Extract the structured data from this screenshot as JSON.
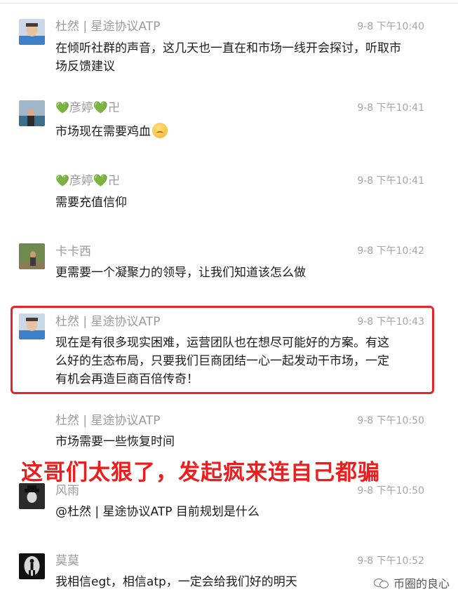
{
  "messages": [
    {
      "sender": "杜然 | 星途协议ATP",
      "time": "9-8 下午10:40",
      "text": "在倾听社群的声音，这几天也一直在和市场一线开会探讨，听取市场反馈建议",
      "avatar": "avatar-man-blue-shirt"
    },
    {
      "sender_prefix": "💚",
      "sender_name": "彦婷",
      "sender_suffix": "💚卍",
      "time": "9-8 下午10:41",
      "text": "市场现在需要鸡血",
      "avatar": "avatar-woman-lake",
      "emoji": "grimacing-face"
    },
    {
      "sender_prefix": "💚",
      "sender_name": "彦婷",
      "sender_suffix": "💚卍",
      "time": "9-8 下午10:41",
      "text": "需要充值信仰"
    },
    {
      "sender": "卡卡西",
      "time": "9-8 下午10:42",
      "text": "更需要一个凝聚力的领导，让我们知道该怎么做",
      "avatar": "avatar-outdoor-person"
    },
    {
      "sender": "杜然 | 星途协议ATP",
      "time": "9-8 下午10:43",
      "text": "现在是有很多现实困难，运营团队也在想尽可能好的方案。有这么好的生态布局，只要我们巨商团结一心一起发动干市场，一定有机会再造巨商百倍传奇！",
      "avatar": "avatar-man-blue-shirt",
      "highlighted": true
    },
    {
      "sender": "杜然 | 星途协议ATP",
      "time": "9-8 下午10:50",
      "text": "市场需要一些恢复时间"
    },
    {
      "sender": "风雨",
      "time": "9-8 下午10:50",
      "text": "@杜然 | 星途协议ATP 目前规划是什么",
      "avatar": "avatar-man-hat-dark"
    },
    {
      "sender": "莫莫",
      "time": "9-8 下午10:52",
      "text": "我相信egt，相信atp，一定会给我们好的明天",
      "avatar": "avatar-silhouette-light"
    }
  ],
  "overlay_caption": "这哥们太狠了，发起疯来连自己都骗",
  "watermark": "币圈的良心",
  "colors": {
    "highlight_border": "#e3262a",
    "caption": "#ee1c1c",
    "heart": "#7ccf3b"
  }
}
